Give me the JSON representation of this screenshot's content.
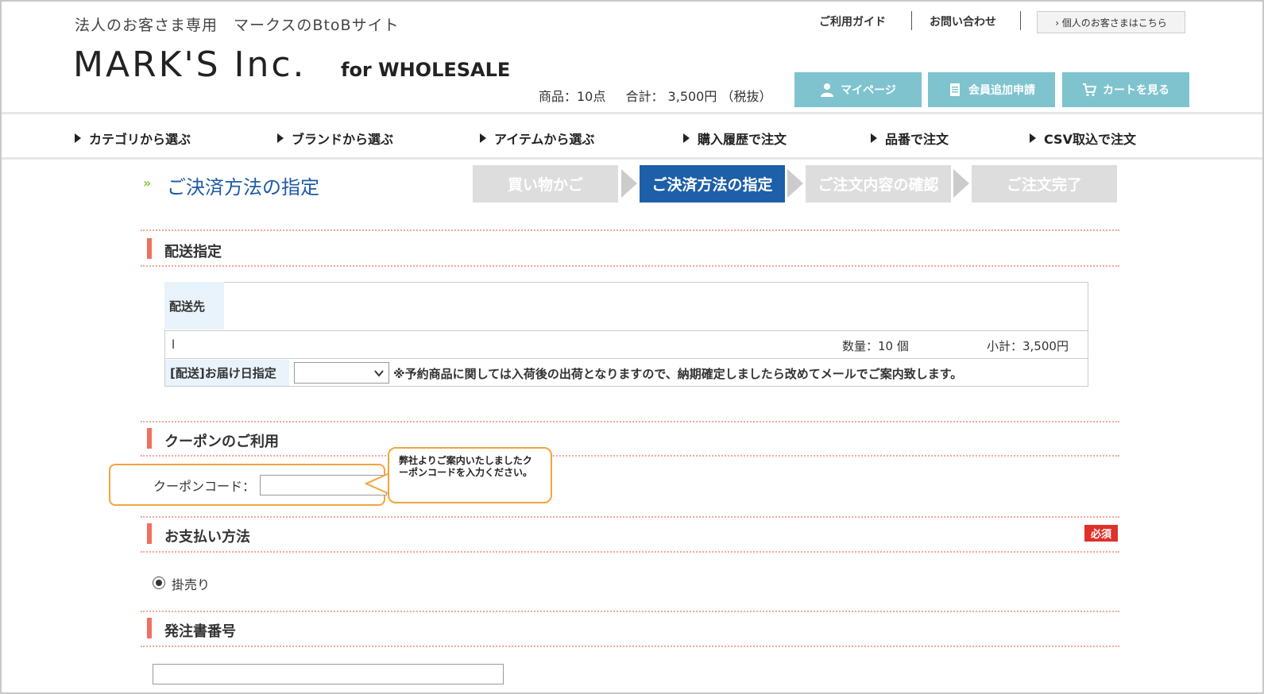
{
  "header": {
    "tagline": "法人のお客さま専用　マークスのBtoBサイト",
    "logo_main": "MARK'S Inc.",
    "logo_sub": "for WHOLESALE",
    "links": {
      "guide": "ご利用ガイド",
      "contact": "お問い合わせ",
      "personal": "› 個人のお客さまはこちら"
    },
    "cart_summary": {
      "items": "商品：10点",
      "total": "合計： 3,500円 （税抜）"
    },
    "buttons": {
      "mypage": "マイページ",
      "member_add": "会員追加申請",
      "cart": "カートを見る"
    },
    "colors": {
      "button_bg": "#7fc3cf"
    }
  },
  "nav": {
    "items": [
      "カテゴリから選ぶ",
      "ブランドから選ぶ",
      "アイテムから選ぶ",
      "購入履歴で注文",
      "品番で注文",
      "CSV取込で注文"
    ]
  },
  "page": {
    "title": "ご決済方法の指定",
    "steps": [
      "買い物かご",
      "ご決済方法の指定",
      "ご注文内容の確認",
      "ご注文完了"
    ],
    "active_step": "ご決済方法の指定",
    "colors": {
      "active_step": "#1d5fa8",
      "inactive_step": "#dddddd",
      "section_bar": "#f07060",
      "highlight": "#f3a43e",
      "required": "#e0302a"
    }
  },
  "shipping": {
    "section_title": "配送指定",
    "destination_label": "配送先",
    "item_marker": "l",
    "quantity": "数量：10 個",
    "subtotal": "小計：3,500円",
    "date_label": "[配送]お届け日指定",
    "date_value": "",
    "note": "※予約商品に関しては入荷後の出荷となりますので、納期確定しましたら改めてメールでご案内致します。"
  },
  "coupon": {
    "section_title": "クーポンのご利用",
    "label": "クーポンコード：",
    "value": "",
    "callout": "弊社よりご案内いたしましたクーポンコードを入力ください。"
  },
  "payment": {
    "section_title": "お支払い方法",
    "required_badge": "必須",
    "option": "掛売り"
  },
  "po": {
    "section_title": "発注書番号",
    "value": ""
  }
}
